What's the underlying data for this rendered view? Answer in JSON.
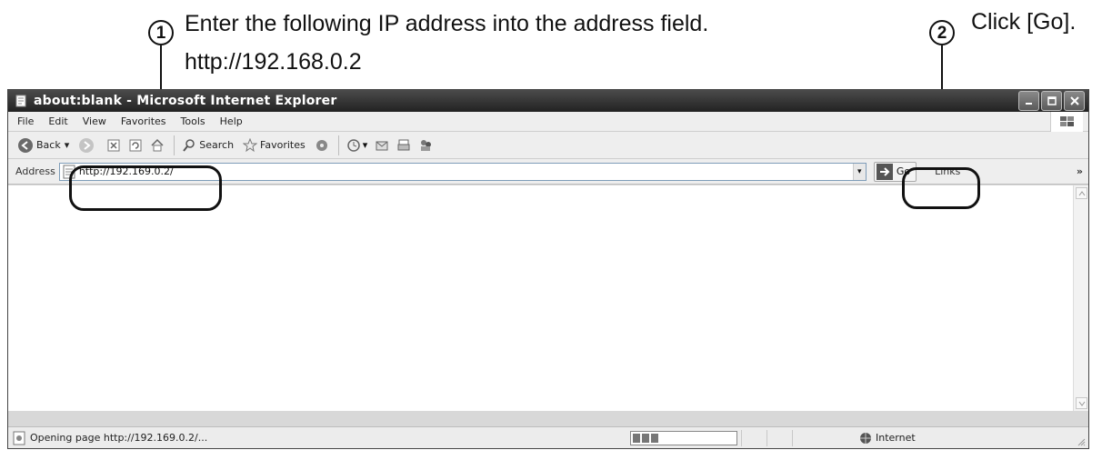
{
  "annotations": {
    "step1_number": "1",
    "step1_line1": "Enter the following IP address into the address field.",
    "step1_line2": "http://192.168.0.2",
    "step2_number": "2",
    "step2_text": "Click [Go]."
  },
  "window": {
    "title": "about:blank - Microsoft Internet Explorer",
    "controls": [
      "minimize",
      "maximize",
      "close"
    ]
  },
  "menu": {
    "items": [
      "File",
      "Edit",
      "View",
      "Favorites",
      "Tools",
      "Help"
    ]
  },
  "toolbar": {
    "back_label": "Back",
    "search_label": "Search",
    "favorites_label": "Favorites"
  },
  "address": {
    "label": "Address",
    "value": "http://192.169.0.2/",
    "go_label": "Go",
    "links_label": "Links",
    "more_label": "»"
  },
  "status": {
    "text": "Opening page http://192.169.0.2/...",
    "zone": "Internet",
    "progress_percent": 10
  },
  "colors": {
    "titlebar": "#333333",
    "chrome": "#eeeeee",
    "highlight": "#111111"
  }
}
